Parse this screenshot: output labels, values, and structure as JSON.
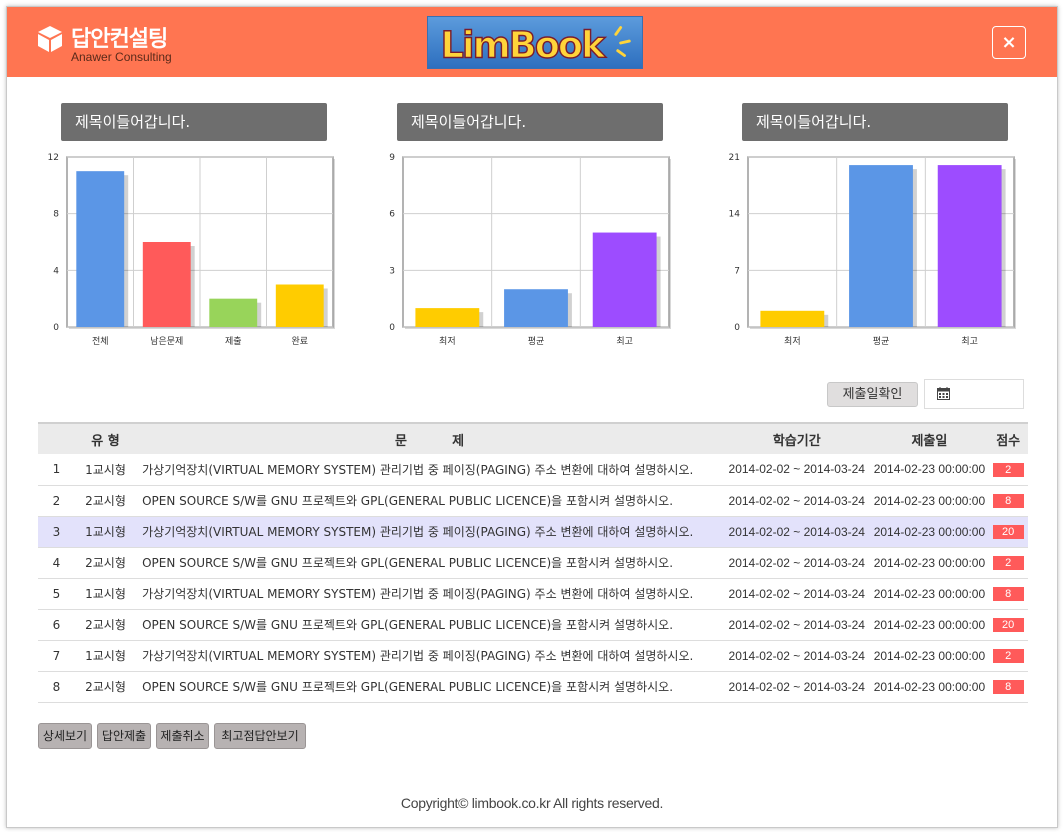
{
  "header": {
    "brand_name": "답안컨설팅",
    "brand_sub": "Anawer Consulting",
    "logo_text": "LimBook",
    "close_label": "×",
    "accent": "#ff7551"
  },
  "charts": [
    {
      "title": "제목이들어갑니다."
    },
    {
      "title": "제목이들어갑니다."
    },
    {
      "title": "제목이들어갑니다."
    }
  ],
  "chart_data": [
    {
      "type": "bar",
      "categories": [
        "전체",
        "남은문제",
        "제출",
        "완료"
      ],
      "values": [
        11,
        6,
        2,
        3
      ],
      "colors": [
        "#5b96e6",
        "#ff5a5a",
        "#98d45a",
        "#ffcc00"
      ],
      "ylim": [
        0,
        12
      ],
      "yticks": [
        0,
        4,
        8,
        12
      ],
      "grid": true
    },
    {
      "type": "bar",
      "categories": [
        "최저",
        "평균",
        "최고"
      ],
      "values": [
        1,
        2,
        5
      ],
      "colors": [
        "#ffcc00",
        "#5b96e6",
        "#9d4cff"
      ],
      "ylim": [
        0,
        9
      ],
      "yticks": [
        0,
        3,
        6,
        9
      ],
      "grid": true
    },
    {
      "type": "bar",
      "categories": [
        "최저",
        "평균",
        "최고"
      ],
      "values": [
        2,
        20,
        20
      ],
      "colors": [
        "#ffcc00",
        "#5b96e6",
        "#9d4cff"
      ],
      "ylim": [
        0,
        21
      ],
      "yticks": [
        0,
        7,
        14,
        21
      ],
      "grid": true
    }
  ],
  "toolbar": {
    "confirm_label": "제출일확인",
    "date_value": ""
  },
  "table": {
    "headers": [
      "",
      "유 형",
      "문          제",
      "학습기간",
      "제출일",
      "점수"
    ],
    "rows": [
      {
        "no": "1",
        "type": "1교시형",
        "question": "가상기억장치(VIRTUAL MEMORY SYSTEM) 관리기법 중 페이징(PAGING) 주소 변환에 대하여 설명하시오.",
        "period": "2014-02-02 ~ 2014-03-24",
        "submitted": "2014-02-23 00:00:00",
        "score": "2"
      },
      {
        "no": "2",
        "type": "2교시형",
        "question": "OPEN SOURCE S/W를 GNU 프로젝트와 GPL(GENERAL PUBLIC LICENCE)을 포함시켜 설명하시오.",
        "period": "2014-02-02 ~ 2014-03-24",
        "submitted": "2014-02-23 00:00:00",
        "score": "8"
      },
      {
        "no": "3",
        "type": "1교시형",
        "question": "가상기억장치(VIRTUAL MEMORY SYSTEM) 관리기법 중 페이징(PAGING) 주소 변환에 대하여 설명하시오.",
        "period": "2014-02-02 ~ 2014-03-24",
        "submitted": "2014-02-23 00:00:00",
        "score": "20"
      },
      {
        "no": "4",
        "type": "2교시형",
        "question": "OPEN SOURCE S/W를 GNU 프로젝트와 GPL(GENERAL PUBLIC LICENCE)을 포함시켜 설명하시오.",
        "period": "2014-02-02 ~ 2014-03-24",
        "submitted": "2014-02-23 00:00:00",
        "score": "2"
      },
      {
        "no": "5",
        "type": "1교시형",
        "question": "가상기억장치(VIRTUAL MEMORY SYSTEM) 관리기법 중 페이징(PAGING) 주소 변환에 대하여 설명하시오.",
        "period": "2014-02-02 ~ 2014-03-24",
        "submitted": "2014-02-23 00:00:00",
        "score": "8"
      },
      {
        "no": "6",
        "type": "2교시형",
        "question": "OPEN SOURCE S/W를 GNU 프로젝트와 GPL(GENERAL PUBLIC LICENCE)을 포함시켜 설명하시오.",
        "period": "2014-02-02 ~ 2014-03-24",
        "submitted": "2014-02-23 00:00:00",
        "score": "20"
      },
      {
        "no": "7",
        "type": "1교시형",
        "question": "가상기억장치(VIRTUAL MEMORY SYSTEM) 관리기법 중 페이징(PAGING) 주소 변환에 대하여 설명하시오.",
        "period": "2014-02-02 ~ 2014-03-24",
        "submitted": "2014-02-23 00:00:00",
        "score": "2"
      },
      {
        "no": "8",
        "type": "2교시형",
        "question": "OPEN SOURCE S/W를 GNU 프로젝트와 GPL(GENERAL PUBLIC LICENCE)을 포함시켜 설명하시오.",
        "period": "2014-02-02 ~ 2014-03-24",
        "submitted": "2014-02-23 00:00:00",
        "score": "8"
      }
    ],
    "highlight_color": "#e3e2fb",
    "score_color": "#ff5a5a"
  },
  "actions": [
    "상세보기",
    "답안제출",
    "제출취소",
    "최고점답안보기"
  ],
  "footer": {
    "text": "Copyright© limbook.co.kr All rights reserved."
  },
  "icons": {
    "brand": "cube-icon",
    "calendar": "calendar-icon",
    "close": "close-icon"
  }
}
